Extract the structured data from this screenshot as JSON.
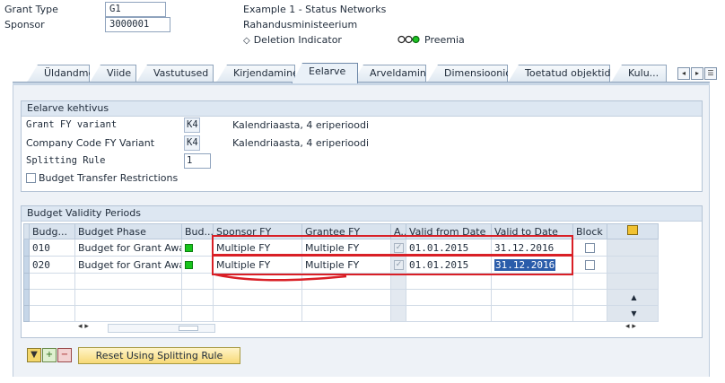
{
  "header": {
    "grant_type_label": "Grant Type",
    "grant_type_value": "G1",
    "grant_type_desc": "Example 1 - Status Networks",
    "sponsor_label": "Sponsor",
    "sponsor_value": "3000001",
    "sponsor_desc": "Rahandusministeerium",
    "deletion_indicator": "Deletion Indicator",
    "status_text": "Preemia"
  },
  "tabs": [
    "Üldandmed",
    "Viide",
    "Vastutused",
    "Kirjendamine",
    "Eelarve",
    "Arveldamine",
    "Dimensioonid",
    "Toetatud objektid",
    "Kulu..."
  ],
  "active_tab": "Eelarve",
  "budget_group": {
    "title": "Eelarve kehtivus",
    "grant_fy_variant_label": "Grant FY variant",
    "grant_fy_variant_value": "K4",
    "grant_fy_variant_desc": "Kalendriaasta, 4 eriperioodi",
    "company_code_fy_label": "Company Code  FY Variant",
    "company_code_fy_value": "K4",
    "company_code_fy_desc": "Kalendriaasta, 4 eriperioodi",
    "splitting_rule_label": "Splitting Rule",
    "splitting_rule_value": "1",
    "budget_transfer_label": "Budget Transfer Restrictions"
  },
  "validity_group": {
    "title": "Budget Validity Periods",
    "columns": [
      "Budg...",
      "Budget Phase",
      "Bud...",
      "Sponsor FY",
      "Grantee FY",
      "A..",
      "Valid from Date",
      "Valid to Date",
      "Block"
    ],
    "rows": [
      {
        "budg": "010",
        "phase": "Budget for Grant Awa...",
        "sponsor_fy": "Multiple FY",
        "grantee_fy": "Multiple FY",
        "valid_from": "01.01.2015",
        "valid_to": "31.12.2016"
      },
      {
        "budg": "020",
        "phase": "Budget for Grant Awa...",
        "sponsor_fy": "Multiple FY",
        "grantee_fy": "Multiple FY",
        "valid_from": "01.01.2015",
        "valid_to": "31.12.2016"
      }
    ]
  },
  "buttons": {
    "reset_label": "Reset Using Splitting Rule"
  },
  "colors": {
    "status_green": "#18c41c",
    "highlight_red": "#d91f26",
    "selection_blue": "#2a5caa"
  }
}
